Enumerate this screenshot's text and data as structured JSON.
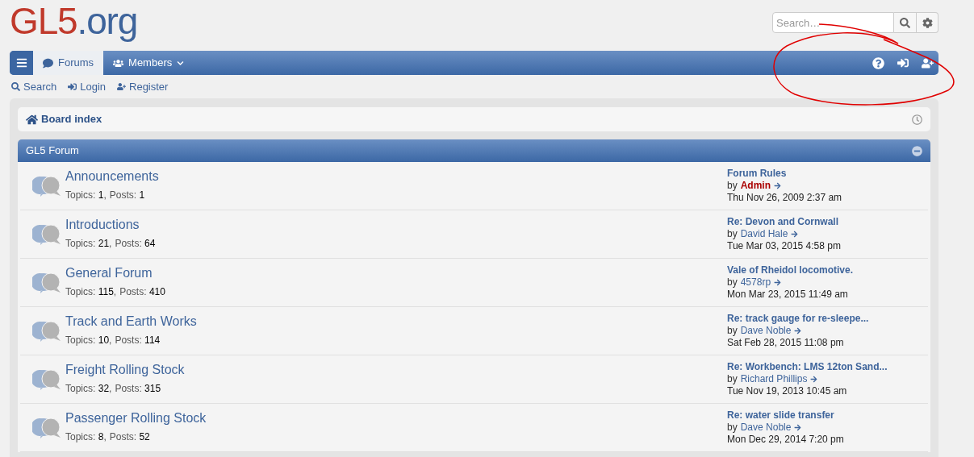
{
  "logo": {
    "part1": "GL5",
    "part2": ".org"
  },
  "search": {
    "placeholder": "Search…"
  },
  "navbar": {
    "tabs": [
      {
        "label": "Forums",
        "selected": true,
        "kind": "forums"
      },
      {
        "label": "Members",
        "selected": false,
        "kind": "members"
      }
    ]
  },
  "quick_links": [
    {
      "label": "Search",
      "kind": "search"
    },
    {
      "label": "Login",
      "kind": "login"
    },
    {
      "label": "Register",
      "kind": "register"
    }
  ],
  "breadcrumb": "Board index",
  "category": {
    "title": "GL5 Forum",
    "forums": [
      {
        "name": "Announcements",
        "topics_label": "Topics:",
        "topics": "1",
        "separator": ",",
        "posts_label": "Posts:",
        "posts": "1",
        "last_title": "Forum Rules",
        "by": "by",
        "author": "Admin",
        "highlighted": true,
        "date": "Thu Nov 26, 2009 2:37 am"
      },
      {
        "name": "Introductions",
        "topics_label": "Topics:",
        "topics": "21",
        "separator": ",",
        "posts_label": "Posts:",
        "posts": "64",
        "last_title": "Re: Devon and Cornwall",
        "by": "by",
        "author": "David Hale",
        "highlighted": false,
        "date": "Tue Mar 03, 2015 4:58 pm"
      },
      {
        "name": "General Forum",
        "topics_label": "Topics:",
        "topics": "115",
        "separator": ",",
        "posts_label": "Posts:",
        "posts": "410",
        "last_title": "Vale of Rheidol locomotive.",
        "by": "by",
        "author": "4578rp",
        "highlighted": false,
        "date": "Mon Mar 23, 2015 11:49 am"
      },
      {
        "name": "Track and Earth Works",
        "topics_label": "Topics:",
        "topics": "10",
        "separator": ",",
        "posts_label": "Posts:",
        "posts": "114",
        "last_title": "Re: track gauge for re-sleepe...",
        "by": "by",
        "author": "Dave Noble",
        "highlighted": false,
        "date": "Sat Feb 28, 2015 11:08 pm"
      },
      {
        "name": "Freight Rolling Stock",
        "topics_label": "Topics:",
        "topics": "32",
        "separator": ",",
        "posts_label": "Posts:",
        "posts": "315",
        "last_title": "Re: Workbench: LMS 12ton Sand...",
        "by": "by",
        "author": "Richard Phillips",
        "highlighted": false,
        "date": "Tue Nov 19, 2013 10:45 am"
      },
      {
        "name": "Passenger Rolling Stock",
        "topics_label": "Topics:",
        "topics": "8",
        "separator": ",",
        "posts_label": "Posts:",
        "posts": "52",
        "last_title": "Re: water slide transfer",
        "by": "by",
        "author": "Dave Noble",
        "highlighted": false,
        "date": "Mon Dec 29, 2014 7:20 pm"
      }
    ]
  }
}
